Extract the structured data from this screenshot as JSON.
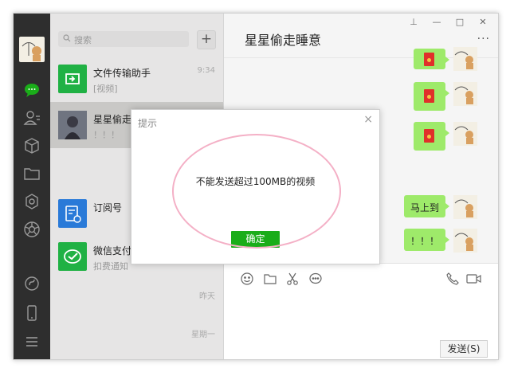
{
  "search": {
    "placeholder": "搜索"
  },
  "nav_icons": [
    "chat-icon",
    "contacts-icon",
    "collections-icon",
    "files-icon",
    "mini-program-icon",
    "moments-icon",
    "mini-program-link-icon",
    "phone-icon",
    "menu-icon"
  ],
  "chats": [
    {
      "name": "文件传输助手",
      "sub": "[视频]",
      "time": "9:34"
    },
    {
      "name": "星星偷走",
      "sub": "！！！",
      "time": ""
    },
    {
      "name": "订阅号",
      "sub": "",
      "time": ""
    },
    {
      "name": "微信支付",
      "sub": "扣费通知",
      "time": ""
    },
    {
      "name": "",
      "sub": "",
      "time": "昨天"
    },
    {
      "name": "",
      "sub": "",
      "time": "星期一"
    }
  ],
  "main": {
    "title": "星星偷走睡意",
    "window_controls": [
      "pin-icon",
      "minimize-icon",
      "maximize-icon",
      "close-icon"
    ],
    "more": "···",
    "messages": [
      "马上到",
      "！！！"
    ],
    "send_label": "发送(S)"
  },
  "dialog": {
    "title": "提示",
    "close": "×",
    "message": "不能发送超过100MB的视频",
    "ok": "确定"
  },
  "colors": {
    "accent": "#1aad19",
    "bubble": "#9eea6a",
    "sidebar": "#2e2e2e",
    "highlight": "#f4b0c6"
  }
}
